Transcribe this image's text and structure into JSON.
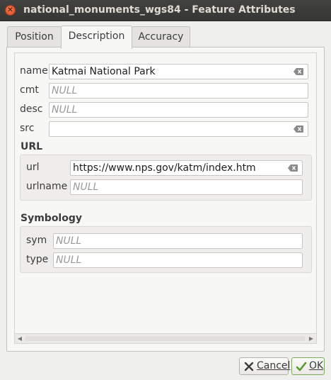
{
  "window": {
    "title": "national_monuments_wgs84 - Feature Attributes"
  },
  "tabs": [
    {
      "label": "Position"
    },
    {
      "label": "Description"
    },
    {
      "label": "Accuracy"
    }
  ],
  "fields": {
    "name": {
      "label": "name",
      "value": "Katmai National Park"
    },
    "cmt": {
      "label": "cmt",
      "placeholder": "NULL"
    },
    "desc": {
      "label": "desc",
      "placeholder": "NULL"
    },
    "src": {
      "label": "src",
      "value": ""
    }
  },
  "url_group": {
    "title": "URL",
    "url": {
      "label": "url",
      "value": "https://www.nps.gov/katm/index.htm"
    },
    "urlname": {
      "label": "urlname",
      "placeholder": "NULL"
    }
  },
  "symbology_group": {
    "title": "Symbology",
    "sym": {
      "label": "sym",
      "placeholder": "NULL"
    },
    "type": {
      "label": "type",
      "placeholder": "NULL"
    }
  },
  "buttons": {
    "cancel": "Cancel",
    "ok": "OK"
  },
  "colors": {
    "accent_close": "#db4a21",
    "ok_check": "#5a9a2a"
  }
}
